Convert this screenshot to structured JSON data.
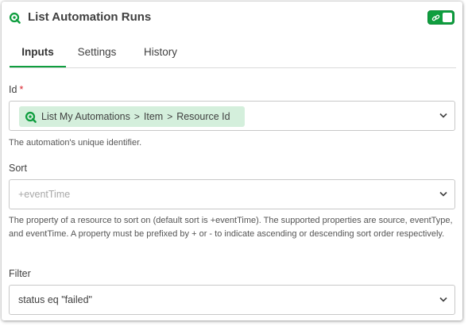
{
  "header": {
    "title": "List Automation Runs",
    "app_icon": "qlik-logo-icon",
    "toggle_icon": "link-icon",
    "accent_color": "#0f9e3f"
  },
  "tabs": [
    {
      "label": "Inputs",
      "active": true
    },
    {
      "label": "Settings",
      "active": false
    },
    {
      "label": "History",
      "active": false
    }
  ],
  "fields": {
    "id": {
      "label": "Id",
      "required_mark": "*",
      "chip": {
        "icon": "qlik-logo-icon",
        "parts": [
          "List My Automations",
          "Item",
          "Resource Id"
        ],
        "separator": ">"
      },
      "help": "The automation's unique identifier."
    },
    "sort": {
      "label": "Sort",
      "placeholder": "+eventTime",
      "help": "The property of a resource to sort on (default sort is +eventTime). The supported properties are source, eventType, and eventTime. A property must be prefixed by + or - to indicate ascending or descending sort order respectively."
    },
    "filter": {
      "label": "Filter",
      "value": "status eq \"failed\""
    }
  }
}
